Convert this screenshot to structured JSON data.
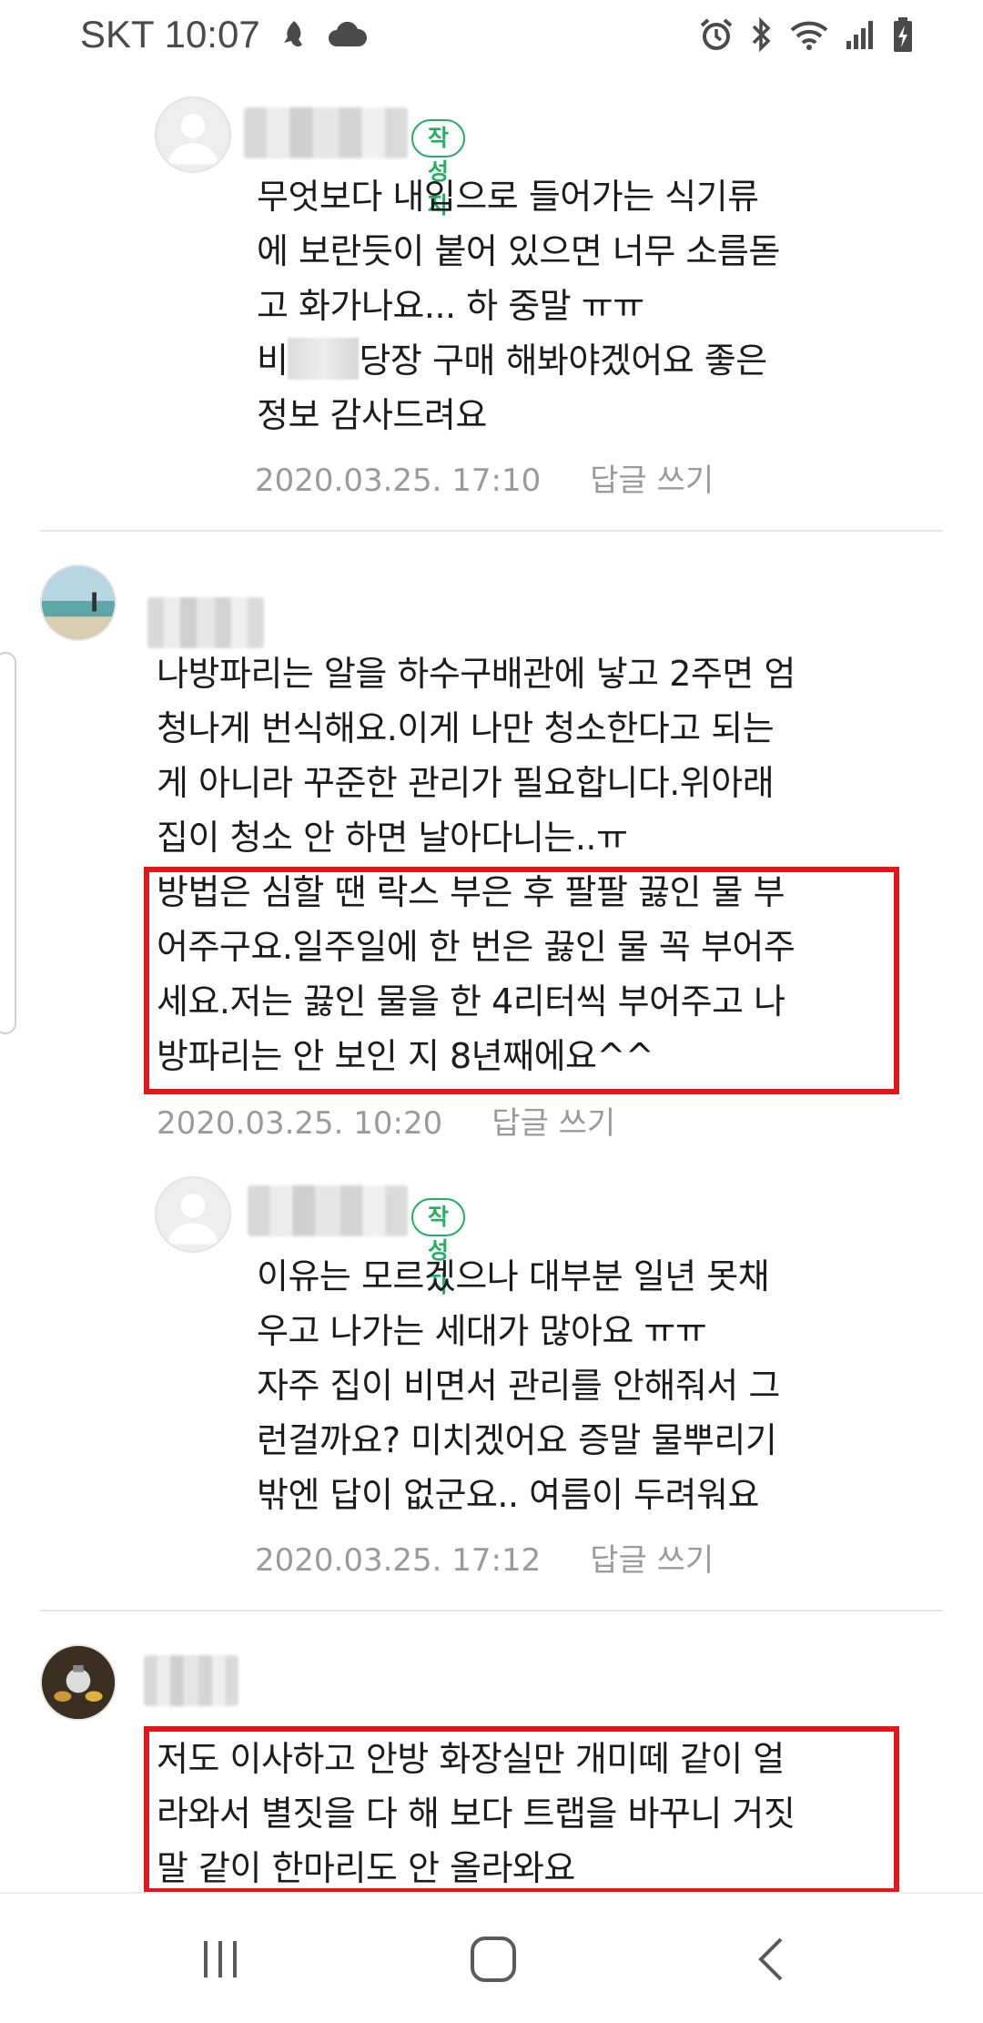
{
  "status_bar": {
    "carrier_time": "SKT 10:07",
    "icons": [
      "notification-icon",
      "cloud-icon",
      "alarm-icon",
      "bluetooth-icon",
      "wifi-icon",
      "signal-icon",
      "battery-icon"
    ]
  },
  "comments": [
    {
      "is_reply": true,
      "author_badge": "작성자",
      "content": "무엇보다 내입으로 들어가는 식기류\n에 보란듯이 붙어 있으면 너무 소름돋\n고 화가나요... 하 중말 ㅠㅠ",
      "content_line_before_blur": "비",
      "content_after_blur": "당장 구매 해봐야겠어요 좋은\n정보 감사드려요",
      "date": "2020.03.25. 17:10",
      "reply_label": "답글 쓰기"
    },
    {
      "is_reply": false,
      "content": "나방파리는 알을 하수구배관에 낳고 2주면 엄\n청나게 번식해요.이게 나만 청소한다고 되는\n게 아니라 꾸준한 관리가 필요합니다.위아래\n집이 청소 안 하면 날아다니는..ㅠ",
      "highlighted_content": "방법은 심할 땐 락스 부은 후 팔팔 끓인 물 부\n어주구요.일주일에 한 번은 끓인 물 꼭 부어주\n세요.저는 끓인 물을 한 4리터씩 부어주고 나\n방파리는 안 보인 지 8년째에요^^",
      "date": "2020.03.25. 10:20",
      "reply_label": "답글 쓰기"
    },
    {
      "is_reply": true,
      "author_badge": "작성자",
      "content": "이유는 모르겠으나 대부분 일년 못채\n우고 나가는 세대가 많아요 ㅠㅠ\n자주 집이 비면서 관리를 안해줘서 그\n런걸까요? 미치겠어요 증말 물뿌리기\n밖엔 답이 없군요.. 여름이 두려워요",
      "date": "2020.03.25. 17:12",
      "reply_label": "답글 쓰기"
    },
    {
      "is_reply": false,
      "highlighted_content": "저도 이사하고 안방 화장실만 개미떼 같이 얼\n라와서 별짓을 다 해 보다 트랩을 바꾸니 거짓\n말 같이 한마리도 안 올라와요"
    }
  ],
  "colors": {
    "badge_green": "#21b05f",
    "highlight_red": "#e4161b",
    "meta_gray": "#9a9a9a"
  },
  "nav_bar": {
    "icons": [
      "recent-apps-icon",
      "home-icon",
      "back-icon"
    ]
  }
}
